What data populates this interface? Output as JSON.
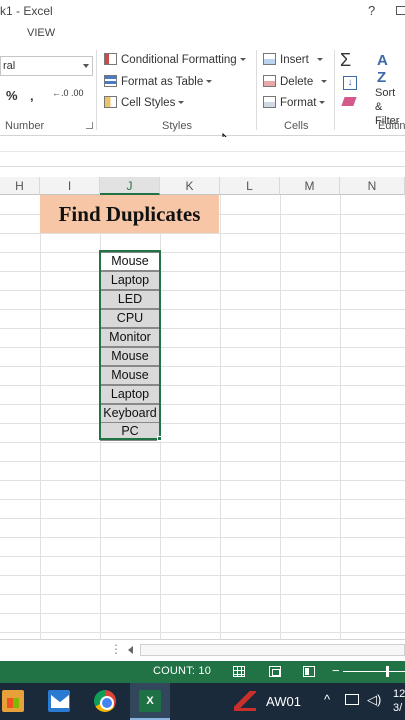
{
  "window": {
    "title": "k1 - Excel",
    "help_glyph": "?"
  },
  "tabs": {
    "view": "VIEW"
  },
  "ribbon": {
    "font_name": "ral",
    "number": {
      "percent": "%",
      "comma": "‚",
      "inc_decimal": "←.0 .00",
      "dec_decimal": ".00 →.0",
      "label": "Number"
    },
    "styles": {
      "conditional_formatting": "Conditional Formatting",
      "format_as_table": "Format as Table",
      "cell_styles": "Cell Styles",
      "label": "Styles"
    },
    "cells": {
      "insert": "Insert",
      "delete": "Delete",
      "format": "Format",
      "label": "Cells"
    },
    "editing": {
      "sort_filter_line1": "Sort &",
      "sort_filter_line2": "Filter",
      "label": "Editin"
    }
  },
  "columns": [
    {
      "label": "H",
      "selected": false
    },
    {
      "label": "I",
      "selected": false
    },
    {
      "label": "J",
      "selected": true
    },
    {
      "label": "K",
      "selected": false
    },
    {
      "label": "L",
      "selected": false
    },
    {
      "label": "M",
      "selected": false
    },
    {
      "label": "N",
      "selected": false
    }
  ],
  "sheet": {
    "title": "Find Duplicates",
    "title_fill": "#f6c6a6",
    "items": [
      "Mouse",
      "Laptop",
      "LED",
      "CPU",
      "Monitor",
      "Mouse",
      "Mouse",
      "Laptop",
      "Keyboard",
      "PC"
    ]
  },
  "status": {
    "count": "COUNT: 10",
    "accent": "#217346"
  },
  "taskbar": {
    "excel_label": "X",
    "app_label": "AW01",
    "time": "12",
    "date": "3/"
  }
}
